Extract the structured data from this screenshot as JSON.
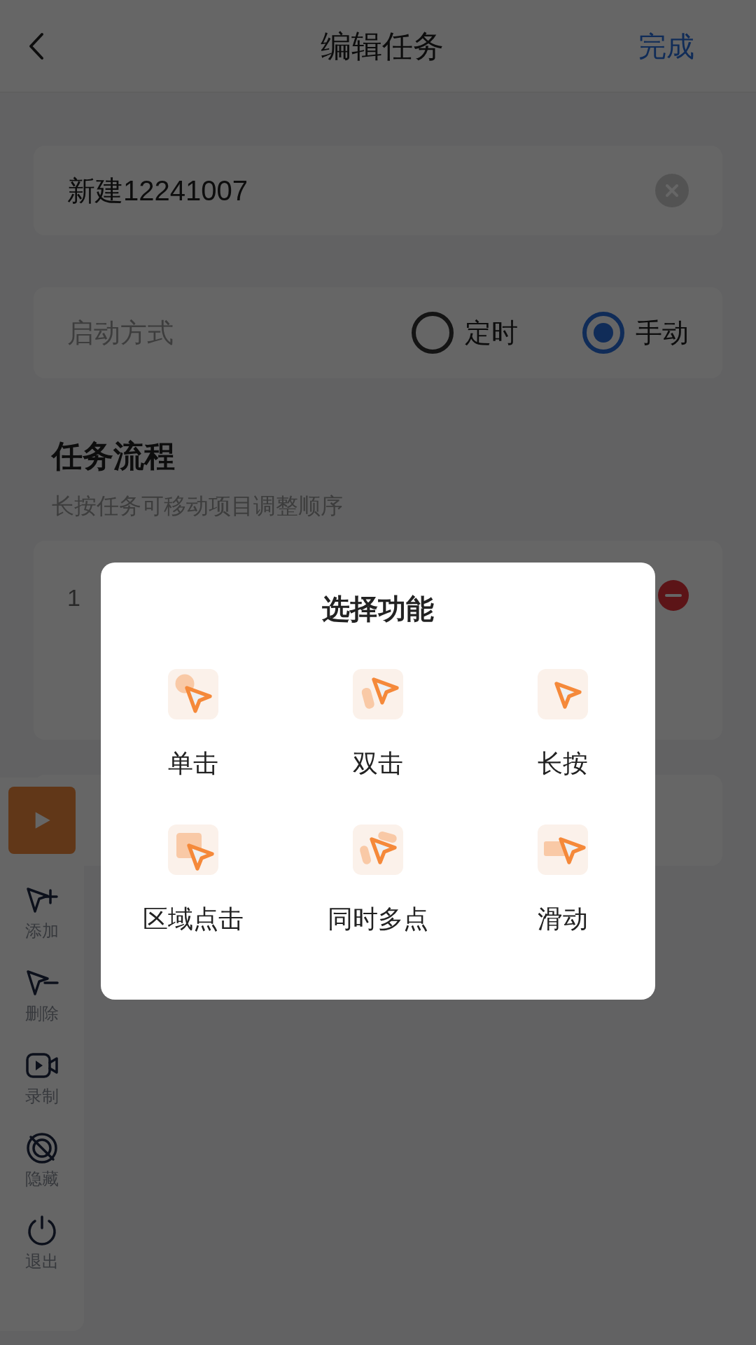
{
  "header": {
    "title": "编辑任务",
    "done": "完成"
  },
  "name_field": {
    "value": "新建12241007"
  },
  "launch": {
    "label": "启动方式",
    "options": [
      {
        "label": "定时",
        "selected": false
      },
      {
        "label": "手动",
        "selected": true
      }
    ]
  },
  "flow": {
    "title": "任务流程",
    "hint": "长按任务可移动项目调整顺序",
    "tasks": [
      {
        "index": "1"
      }
    ]
  },
  "toolbar": {
    "items": [
      {
        "kind": "add",
        "label": "添加"
      },
      {
        "kind": "remove",
        "label": "删除"
      },
      {
        "kind": "record",
        "label": "录制"
      },
      {
        "kind": "hide",
        "label": "隐藏"
      },
      {
        "kind": "exit",
        "label": "退出"
      }
    ]
  },
  "dialog": {
    "title": "选择功能",
    "options": [
      {
        "kind": "tap",
        "label": "单击"
      },
      {
        "kind": "double",
        "label": "双击"
      },
      {
        "kind": "long",
        "label": "长按"
      },
      {
        "kind": "area",
        "label": "区域点击"
      },
      {
        "kind": "multi",
        "label": "同时多点"
      },
      {
        "kind": "swipe",
        "label": "滑动"
      }
    ]
  }
}
